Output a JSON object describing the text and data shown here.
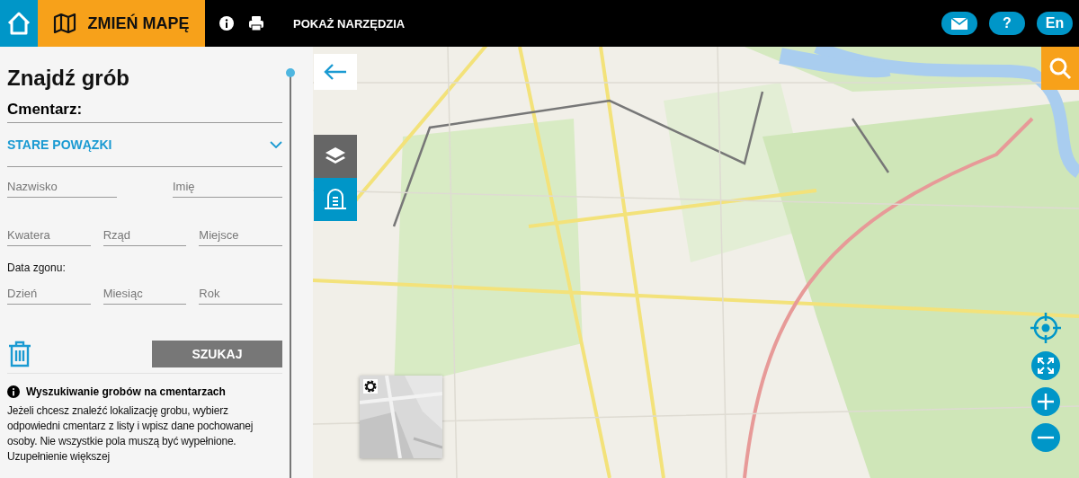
{
  "header": {
    "change_map": "ZMIEŃ MAPĘ",
    "show_tools": "POKAŻ NARZĘDZIA",
    "help": "?",
    "language": "En"
  },
  "panel": {
    "title": "Znajdź grób",
    "cemetery_label": "Cmentarz:",
    "cemetery": "STARE POWĄZKI",
    "name_fields": [
      {
        "placeholder": "Nazwisko"
      },
      {
        "placeholder": "Imię"
      }
    ],
    "location_fields": [
      {
        "placeholder": "Kwatera"
      },
      {
        "placeholder": "Rząd"
      },
      {
        "placeholder": "Miejsce"
      }
    ],
    "date_label": "Data zgonu:",
    "date_fields": [
      {
        "placeholder": "Dzień"
      },
      {
        "placeholder": "Miesiąc"
      },
      {
        "placeholder": "Rok"
      }
    ],
    "search_button": "SZUKAJ",
    "info_title": "Wyszukiwanie grobów na cmentarzach",
    "info_text": "Jeżeli chcesz znaleźć lokalizację grobu, wybierz odpowiedni cmentarz z listy i wpisz dane pochowanej osoby. Nie wszystkie pola muszą być wypełnione. Uzupełnienie większej"
  },
  "map": {
    "kind": "picture"
  }
}
